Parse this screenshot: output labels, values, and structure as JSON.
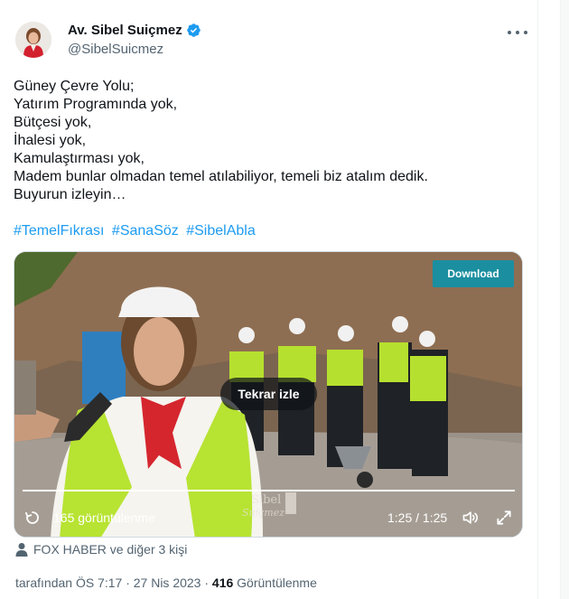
{
  "author": {
    "display_name": "Av. Sibel Suiçmez",
    "handle": "@SibelSuicmez",
    "verified": true
  },
  "more_label": "•••",
  "tweet": {
    "lines": [
      "Güney Çevre Yolu;",
      "Yatırım Programında yok,",
      "Bütçesi yok,",
      "İhalesi yok,",
      "Kamulaştırması yok,",
      "Madem bunlar olmadan temel atılabiliyor, temeli biz atalım dedik.",
      "Buyurun izleyin…"
    ],
    "hashtags": [
      "#TemelFıkrası",
      "#SanaSöz",
      "#SibelAbla"
    ]
  },
  "video": {
    "download_label": "Download",
    "replay_label": "Tekrar izle",
    "views_label": "165 görüntülenme",
    "time_label": "1:25 / 1:25",
    "progress": 1.0,
    "watermark": "Sibel Suiçmez"
  },
  "tagged": {
    "text": "FOX HABER ve diğer 3 kişi"
  },
  "meta": {
    "prefix": "tarafından ÖS 7:17 · 27 Nis 2023 · ",
    "views_count": "416",
    "views_label": " Görüntülenme"
  },
  "colors": {
    "accent": "#1d9bf0",
    "download_button": "#1b8ea0",
    "secondary_text": "#536471"
  }
}
